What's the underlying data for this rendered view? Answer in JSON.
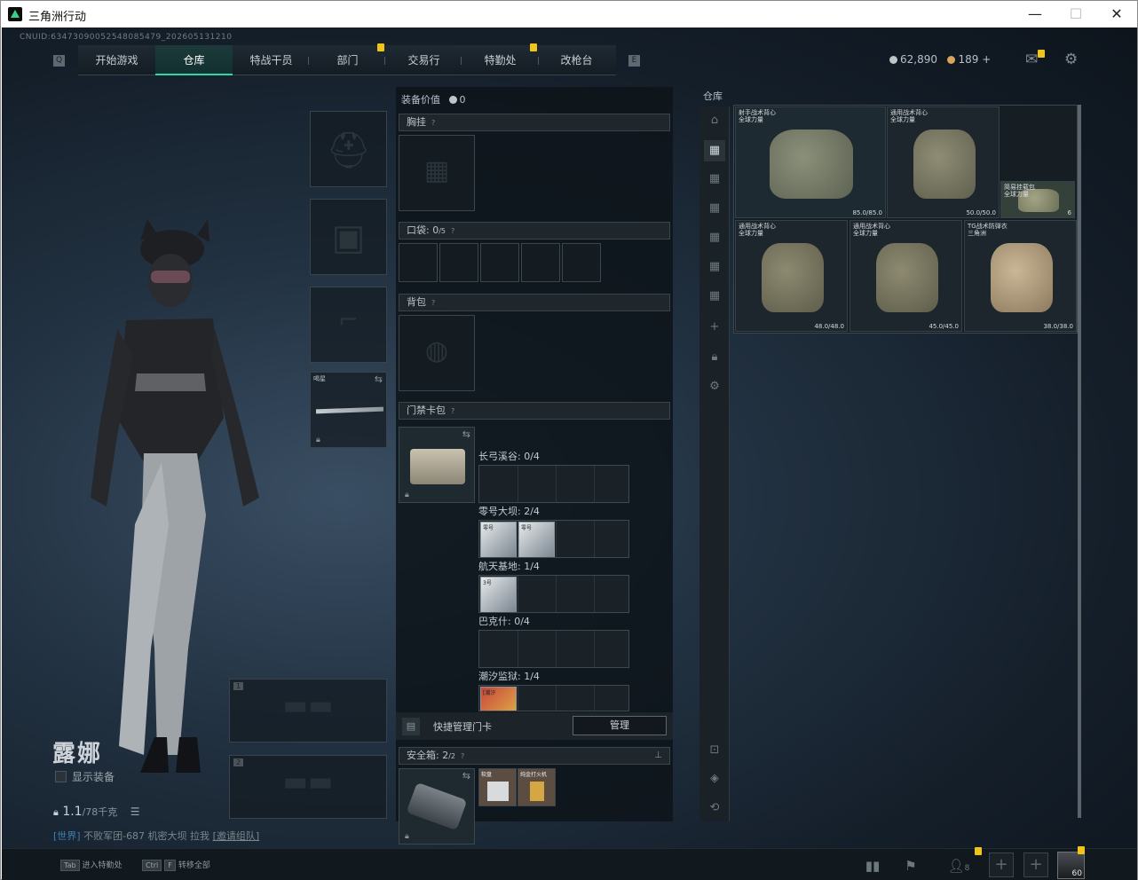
{
  "window": {
    "title": "三角洲行动",
    "minimize": "—",
    "maximize": "☐",
    "close": "✕"
  },
  "uid": "CNUID:63473090052548085479_202605131210",
  "nav": {
    "left_key": "Q",
    "right_key": "E",
    "tabs": [
      {
        "label": "开始游戏"
      },
      {
        "label": "仓库"
      },
      {
        "label": "特战干员"
      },
      {
        "label": "部门"
      },
      {
        "label": "交易行"
      },
      {
        "label": "特勤处"
      },
      {
        "label": "改枪台"
      }
    ],
    "active": "仓库"
  },
  "currency": {
    "silver": "62,890",
    "gold": "189",
    "gold_add": "+",
    "silver_color": "#bfc5c9",
    "gold_color": "#d9a45b"
  },
  "character": {
    "name": "露娜",
    "show_equip": "显示装备",
    "weight": "1.1",
    "weight_max": "/78千克",
    "status_tag": "[世界]",
    "status_text": "不败军团-687  机密大坝  拉我",
    "status_link": "[邀请组队]"
  },
  "loadout": {
    "melee_label": "喝星",
    "slot1": "1",
    "slot2": "2"
  },
  "equipment": {
    "value_label": "装备价值",
    "value": "0",
    "chest": {
      "label": "胸挂",
      "help": "?"
    },
    "pockets": {
      "label": "口袋:",
      "count": "0",
      "max": "/5",
      "help": "?"
    },
    "backpack": {
      "label": "背包",
      "help": "?"
    },
    "keycase": {
      "label": "门禁卡包",
      "help": "?"
    },
    "maps": [
      {
        "name": "长弓溪谷",
        "count": "0/4"
      },
      {
        "name": "零号大坝",
        "count": "2/4"
      },
      {
        "name": "航天基地",
        "count": "1/4"
      },
      {
        "name": "巴克什",
        "count": "0/4"
      },
      {
        "name": "潮汐监狱",
        "count": "1/4"
      }
    ],
    "card_tags": [
      "零号",
      "零号",
      "3号",
      "[潮汐"
    ],
    "quick_manage": "快捷管理门卡",
    "manage_btn": "管理",
    "safebox": {
      "label": "安全箱:",
      "count": "2",
      "max": "/2",
      "help": "?",
      "items": [
        "软盘",
        "纯金打火机"
      ]
    }
  },
  "warehouse": {
    "label": "仓库",
    "vests": [
      {
        "name": "射手战术背心\n全球力量",
        "dur": "85.0/85.0"
      },
      {
        "name": "通用战术背心\n全球力量",
        "dur": "50.0/50.0"
      },
      {
        "name": "简易挂载包\n全球力量",
        "dur": "6"
      },
      {
        "name": "通用战术背心\n全球力量",
        "dur": "48.0/48.0"
      },
      {
        "name": "通用战术背心\n全球力量",
        "dur": "45.0/45.0"
      },
      {
        "name": "TG战术防弹衣\n三角洲",
        "dur": "38.0/38.0"
      }
    ]
  },
  "bottom": {
    "hint1_key": "Tab",
    "hint1": "进入特勤处",
    "hint2_key1": "Ctrl",
    "hint2_key2": "F",
    "hint2": "转移全部",
    "squad_count": "8",
    "level": "60"
  },
  "icons": [
    "shield-icon",
    "mail-icon",
    "gear-icon",
    "lock-icon",
    "swap-icon",
    "pin-icon",
    "plus-icon",
    "stats-icon",
    "flag-icon",
    "person-icon",
    "helmet-icon",
    "list-icon"
  ]
}
